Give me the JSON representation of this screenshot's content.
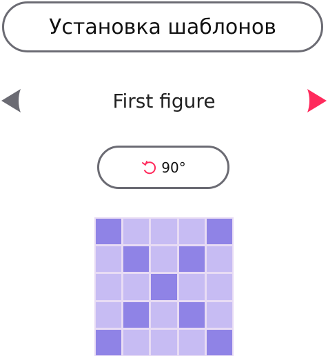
{
  "header": {
    "title": "Установка шаблонов"
  },
  "navigator": {
    "figure_name": "First figure",
    "prev_icon": "triangle-left-icon",
    "next_icon": "triangle-right-icon",
    "prev_color": "#6b6b73",
    "next_color": "#ff2a5c"
  },
  "rotate": {
    "icon": "rotate-ccw-icon",
    "icon_color": "#ff2a5c",
    "label": "90°"
  },
  "pattern": {
    "filled_color": "#8f83e6",
    "empty_color": "#c7bcf3",
    "rows": [
      [
        1,
        0,
        0,
        0,
        1
      ],
      [
        0,
        1,
        0,
        1,
        0
      ],
      [
        0,
        0,
        1,
        0,
        0
      ],
      [
        0,
        1,
        0,
        1,
        0
      ],
      [
        1,
        0,
        0,
        0,
        1
      ]
    ]
  }
}
